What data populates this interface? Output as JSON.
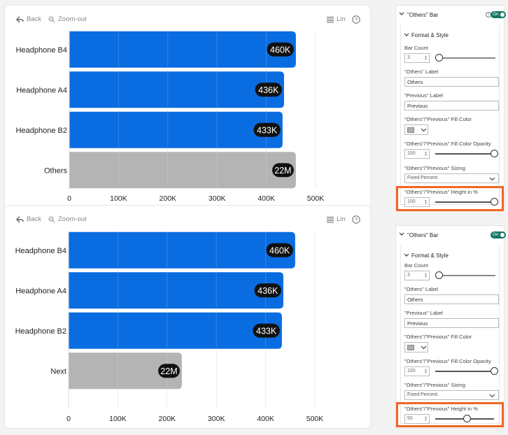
{
  "toolbar": {
    "back_label": "Back",
    "zoom_label": "Zoom-out",
    "scale_label": "Lin",
    "help_label": "?"
  },
  "charts": [
    {
      "chart_data": {
        "type": "bar",
        "orientation": "horizontal",
        "categories": [
          "Headphone B4",
          "Headphone A4",
          "Headphone B2",
          "Others"
        ],
        "values": [
          460000,
          436000,
          433000,
          460000
        ],
        "data_labels": [
          "460K",
          "436K",
          "433K",
          "22M"
        ],
        "bar_colors": [
          "#0a6ce1",
          "#0a6ce1",
          "#0a6ce1",
          "#b4b4b4"
        ],
        "xlim": [
          0,
          500000
        ],
        "xticks": [
          0,
          100000,
          200000,
          300000,
          400000,
          500000
        ],
        "xtick_labels": [
          "0",
          "100K",
          "200K",
          "300K",
          "400K",
          "500K"
        ],
        "grid": true
      }
    },
    {
      "chart_data": {
        "type": "bar",
        "orientation": "horizontal",
        "categories": [
          "Headphone B4",
          "Headphone A4",
          "Headphone B2",
          "Next"
        ],
        "values": [
          460000,
          436000,
          433000,
          230000
        ],
        "data_labels": [
          "460K",
          "436K",
          "433K",
          "22M"
        ],
        "bar_colors": [
          "#0a6ce1",
          "#0a6ce1",
          "#0a6ce1",
          "#b4b4b4"
        ],
        "xlim": [
          0,
          500000
        ],
        "xticks": [
          0,
          100000,
          200000,
          300000,
          400000,
          500000
        ],
        "xtick_labels": [
          "0",
          "100K",
          "200K",
          "300K",
          "400K",
          "500K"
        ],
        "grid": true
      }
    }
  ],
  "panels": [
    {
      "title": "\"Others\" Bar",
      "toggle_label": "On",
      "section": "Format & Style",
      "bar_count_label": "Bar Count",
      "bar_count_value": "3",
      "others_label_label": "\"Others\" Label",
      "others_label_value": "Others",
      "previous_label_label": "\"Previous\" Label",
      "previous_label_value": "Previous",
      "fill_color_label": "\"Others\"/\"Previous\" Fill Color",
      "fill_opacity_label": "\"Others\"/\"Previous\" Fill Color Opacity",
      "fill_opacity_value": "100",
      "sizing_label": "\"Others\"/\"Previous\" Sizing",
      "sizing_value": "Fixed Percent",
      "height_label": "\"Others\"/\"Previous\" Height in %",
      "height_value": "100",
      "height_fraction": 1.0
    },
    {
      "title": "\"Others\" Bar",
      "toggle_label": "On",
      "section": "Format & Style",
      "bar_count_label": "Bar Count",
      "bar_count_value": "3",
      "others_label_label": "\"Others\" Label",
      "others_label_value": "Others",
      "previous_label_label": "\"Previous\" Label",
      "previous_label_value": "Previous",
      "fill_color_label": "\"Others\"/\"Previous\" Fill Color",
      "fill_opacity_label": "\"Others\"/\"Previous\" Fill Color Opacity",
      "fill_opacity_value": "100",
      "sizing_label": "\"Others\"/\"Previous\" Sizing",
      "sizing_value": "Fixed Percent",
      "height_label": "\"Others\"/\"Previous\" Height in %",
      "height_value": "50",
      "height_fraction": 0.5
    }
  ],
  "colors": {
    "bar_blue": "#0a6ce1",
    "bar_gray": "#b4b4b4",
    "label_bg": "#111111",
    "highlight": "#f26522",
    "toggle_on": "#117865"
  }
}
